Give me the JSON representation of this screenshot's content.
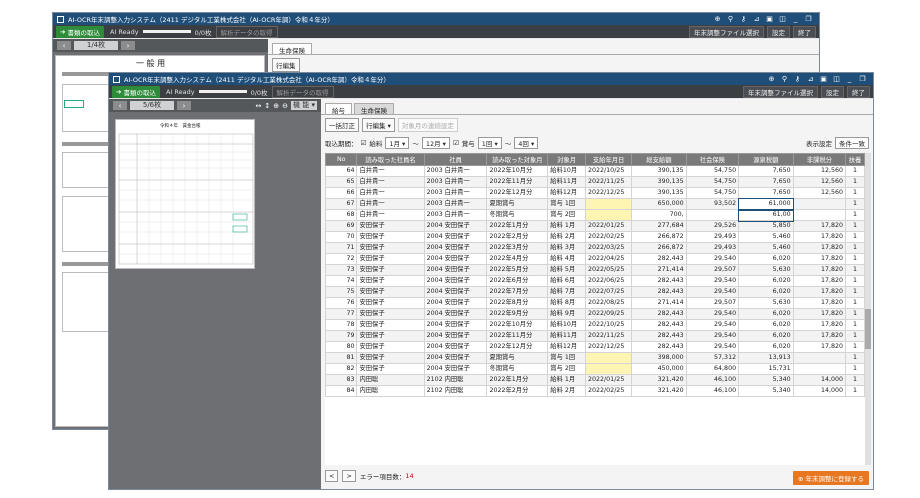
{
  "back_window": {
    "title": "AI-OCR年末調整入力システム（2411 デジタル工業株式会社（AI-OCR年調）令和４年分）",
    "pager": "1/4枚",
    "tab": "生命保険",
    "doc_heading": "一 般 用",
    "subtab_label": "行編集"
  },
  "window": {
    "title": "AI-OCR年末調整入力システム（2411 デジタル工業株式会社（AI-OCR年調）令和４年分）",
    "toolbar": {
      "import_label": "書類の取込",
      "ai_status": "AI Ready",
      "progress_text": "0/0枚",
      "save_analysis_label": "解析データの取得",
      "file_select_label": "年末調整ファイル選択",
      "settings_label": "設定",
      "exit_label": "終了"
    },
    "viewer": {
      "pager": "5/6枚",
      "menu_label": "機 能",
      "doc_title": "令和４年　賃金台帳"
    },
    "tabs": [
      "給与",
      "生命保険"
    ],
    "sub": {
      "bulk_fix": "一括訂正",
      "row_edit": "行編集",
      "continuous": "対象月の連続設定"
    },
    "filter": {
      "label": "取込期間：",
      "salary": "給料",
      "from_month": "1月",
      "to_month": "12月",
      "bonus": "賞与",
      "bonus_from": "1回",
      "bonus_to": "4回",
      "display_settings": "表示設定",
      "condition": "条件一致"
    },
    "columns": [
      "No",
      "読み取った社員名",
      "社員",
      "読み取った対象月",
      "対象月",
      "支給年月日",
      "総支給額",
      "社会保険",
      "源泉税額",
      "非課税分",
      "扶養"
    ],
    "rows": [
      [
        "64",
        "白井貴一",
        "2003 白井貴一",
        "2022年10月分",
        "給料10月",
        "2022/10/25",
        "390,135",
        "54,750",
        "7,650",
        "12,560",
        "1"
      ],
      [
        "65",
        "白井貴一",
        "2003 白井貴一",
        "2022年11月分",
        "給料11月",
        "2022/11/25",
        "390,135",
        "54,750",
        "7,650",
        "12,560",
        "1"
      ],
      [
        "66",
        "白井貴一",
        "2003 白井貴一",
        "2022年12月分",
        "給料12月",
        "2022/12/25",
        "390,135",
        "54,750",
        "7,650",
        "12,560",
        "1"
      ],
      [
        "67",
        "白井貴一",
        "2003 白井貴一",
        "夏期賞与",
        "賞与 1回",
        "",
        "650,000",
        "93,502",
        "61,000",
        "",
        "1"
      ],
      [
        "68",
        "白井貴一",
        "2003 白井貴一",
        "冬期賞与",
        "賞与 2回",
        "",
        "700,",
        "",
        "61,00",
        "",
        "1"
      ],
      [
        "69",
        "安田保子",
        "2004 安田保子",
        "2022年1月分",
        "給料 1月",
        "2022/01/25",
        "277,684",
        "29,526",
        "5,850",
        "17,820",
        "1"
      ],
      [
        "70",
        "安田保子",
        "2004 安田保子",
        "2022年2月分",
        "給料 2月",
        "2022/02/25",
        "266,872",
        "29,493",
        "5,460",
        "17,820",
        "1"
      ],
      [
        "71",
        "安田保子",
        "2004 安田保子",
        "2022年3月分",
        "給料 3月",
        "2022/03/25",
        "266,872",
        "29,493",
        "5,460",
        "17,820",
        "1"
      ],
      [
        "72",
        "安田保子",
        "2004 安田保子",
        "2022年4月分",
        "給料 4月",
        "2022/04/25",
        "282,443",
        "29,540",
        "6,020",
        "17,820",
        "1"
      ],
      [
        "73",
        "安田保子",
        "2004 安田保子",
        "2022年5月分",
        "給料 5月",
        "2022/05/25",
        "271,414",
        "29,507",
        "5,630",
        "17,820",
        "1"
      ],
      [
        "74",
        "安田保子",
        "2004 安田保子",
        "2022年6月分",
        "給料 6月",
        "2022/06/25",
        "282,443",
        "29,540",
        "6,020",
        "17,820",
        "1"
      ],
      [
        "75",
        "安田保子",
        "2004 安田保子",
        "2022年7月分",
        "給料 7月",
        "2022/07/25",
        "282,443",
        "29,540",
        "6,020",
        "17,820",
        "1"
      ],
      [
        "76",
        "安田保子",
        "2004 安田保子",
        "2022年8月分",
        "給料 8月",
        "2022/08/25",
        "271,414",
        "29,507",
        "5,630",
        "17,820",
        "1"
      ],
      [
        "77",
        "安田保子",
        "2004 安田保子",
        "2022年9月分",
        "給料 9月",
        "2022/09/25",
        "282,443",
        "29,540",
        "6,020",
        "17,820",
        "1"
      ],
      [
        "78",
        "安田保子",
        "2004 安田保子",
        "2022年10月分",
        "給料10月",
        "2022/10/25",
        "282,443",
        "29,540",
        "6,020",
        "17,820",
        "1"
      ],
      [
        "79",
        "安田保子",
        "2004 安田保子",
        "2022年11月分",
        "給料11月",
        "2022/11/25",
        "282,443",
        "29,540",
        "6,020",
        "17,820",
        "1"
      ],
      [
        "80",
        "安田保子",
        "2004 安田保子",
        "2022年12月分",
        "給料12月",
        "2022/12/25",
        "282,443",
        "29,540",
        "6,020",
        "17,820",
        "1"
      ],
      [
        "81",
        "安田保子",
        "2004 安田保子",
        "夏期賞与",
        "賞与 1回",
        "",
        "398,000",
        "57,312",
        "13,913",
        "",
        "1"
      ],
      [
        "82",
        "安田保子",
        "2004 安田保子",
        "冬期賞与",
        "賞与 2回",
        "",
        "450,000",
        "64,800",
        "15,731",
        "",
        "1"
      ],
      [
        "83",
        "内田聡",
        "2102 内田聡",
        "2022年1月分",
        "給料 1月",
        "2022/01/25",
        "321,420",
        "46,100",
        "5,340",
        "14,000",
        "1"
      ],
      [
        "84",
        "内田聡",
        "2102 内田聡",
        "2022年2月分",
        "給料 2月",
        "2022/02/25",
        "321,420",
        "46,100",
        "5,340",
        "14,000",
        "1"
      ]
    ],
    "footer": {
      "error_label": "エラー項目数：",
      "error_count": "14",
      "register_label": "年末調整に登録する"
    }
  }
}
